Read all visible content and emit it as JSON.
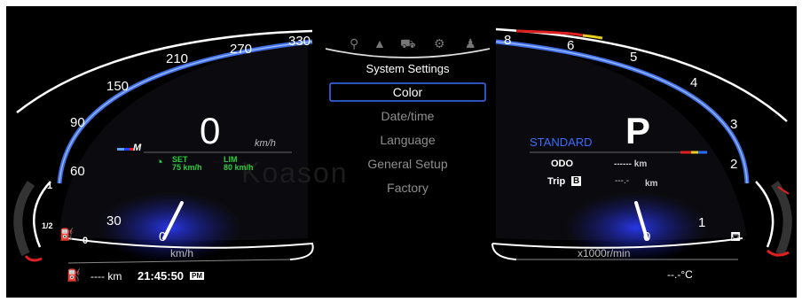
{
  "speedometer": {
    "ticks": [
      "0",
      "30",
      "60",
      "90",
      "150",
      "210",
      "270",
      "330"
    ],
    "unit": "km/h",
    "speed": "0",
    "speed_unit": "km/h",
    "brand_badge": "M",
    "cruise": {
      "set_label": "SET",
      "set_value": "75 km/h",
      "lim_label": "LIM",
      "lim_value": "80 km/h"
    }
  },
  "fuel": {
    "full": "1",
    "half": "1/2",
    "empty": "0"
  },
  "bottom_left": {
    "range": "---- km",
    "time": "21:45:50",
    "ampm": "PM"
  },
  "menu": {
    "title": "System Settings",
    "items": [
      "Color",
      "Date/time",
      "Language",
      "General Setup",
      "Factory"
    ],
    "selected_index": 0,
    "icons": [
      "location-icon",
      "warning-icon",
      "car-icon",
      "gear-icon",
      "shirt-icon"
    ]
  },
  "tachometer": {
    "ticks": [
      "0",
      "1",
      "2",
      "3",
      "4",
      "5",
      "6",
      "8"
    ],
    "unit": "x1000r/min",
    "gear": "P",
    "mode": "STANDARD",
    "odo_label": "ODO",
    "odo_value": "------ km",
    "trip_label": "Trip",
    "trip_badge": "B",
    "trip_value": "---.-",
    "trip_unit": "km"
  },
  "temperature": {
    "value": "--.-°C"
  },
  "watermark": "Koason",
  "colors": {
    "accent_blue": "#3a6cff",
    "cruise_green": "#2ecc40",
    "needle": "#ffffff",
    "redline": "#e02020"
  }
}
